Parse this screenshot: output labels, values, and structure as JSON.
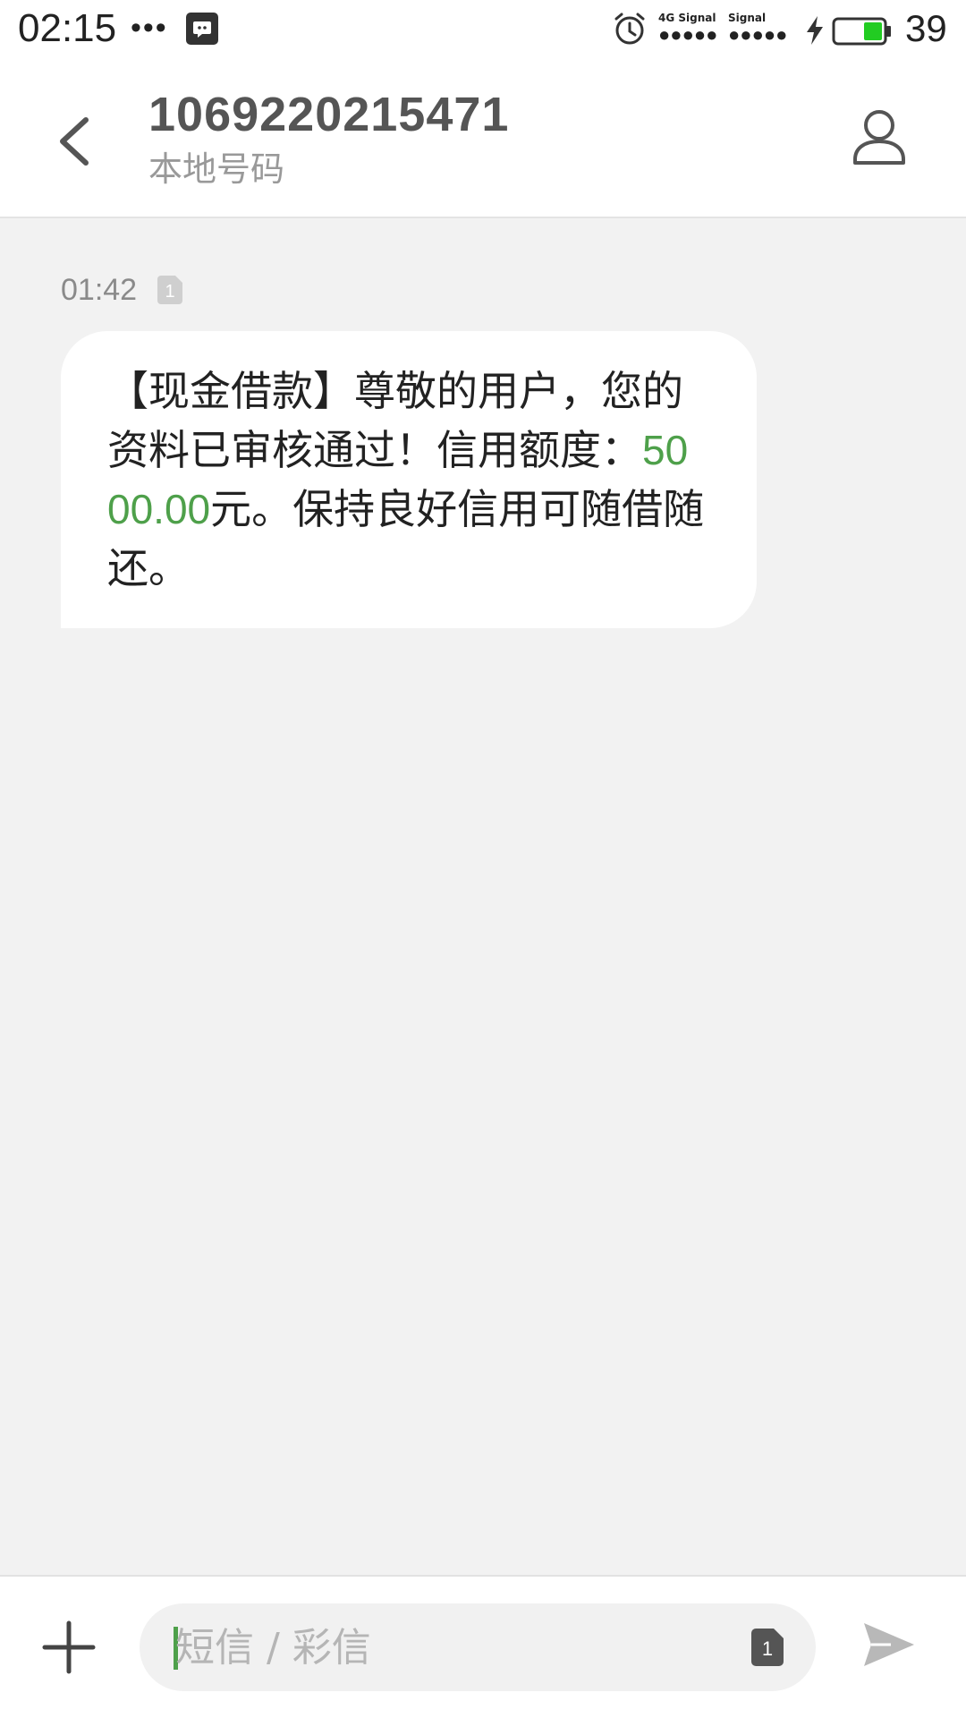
{
  "status_bar": {
    "time": "02:15",
    "more": "•••",
    "signal_1_label": "4G Signal",
    "signal_2_label": "Signal",
    "signal_dots": "●●●●●",
    "battery_level": "39",
    "battery_fill_fraction": 0.39,
    "battery_color": "#22cc22"
  },
  "header": {
    "contact_number": "1069220215471",
    "contact_subtitle": "本地号码"
  },
  "thread": {
    "messages": [
      {
        "time": "01:42",
        "sim": "1",
        "text_before": "【现金借款】尊敬的用户，您的资料已审核通过！信用额度：",
        "amount": "5000.00",
        "text_after": "元。保持良好信用可随借随还。"
      }
    ]
  },
  "composer": {
    "placeholder": "短信 / 彩信",
    "sim": "1"
  },
  "colors": {
    "accent_green": "#4ea04a",
    "thread_bg": "#f2f2f2",
    "bubble_bg": "#ffffff"
  }
}
